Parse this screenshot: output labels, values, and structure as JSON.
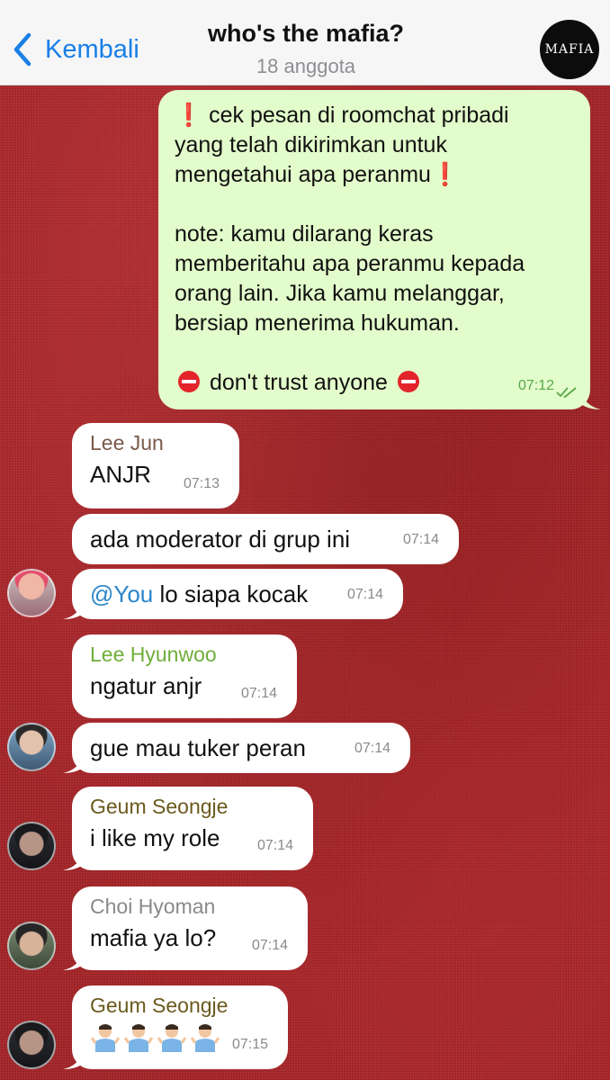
{
  "header": {
    "back_label": "Kembali",
    "title": "who's the mafia?",
    "subtitle": "18 anggota",
    "avatar_text": "MAFIA"
  },
  "colors": {
    "link_blue": "#1a7fe6",
    "outgoing_bubble": "#e3fccb",
    "incoming_bubble": "#ffffff",
    "background_red": "#a5262a"
  },
  "messages": [
    {
      "direction": "out",
      "line1": "cek pesan di roomchat pribadi",
      "line2": "yang telah dikirimkan untuk",
      "line3": "mengetahui apa peranmu",
      "note1": "note: kamu dilarang keras",
      "note2": "memberitahu apa peranmu kepada",
      "note3": "orang lain. Jika kamu melanggar,",
      "note4": "bersiap menerima hukuman.",
      "footer": "don't trust anyone",
      "time": "07:12",
      "status_icon": "double-check-icon"
    },
    {
      "direction": "in",
      "sender": "Lee Jun",
      "sender_color": "#7a5a4b",
      "text": "ANJR",
      "time": "07:13"
    },
    {
      "direction": "in",
      "text": "ada moderator di grup ini",
      "time": "07:14"
    },
    {
      "direction": "in",
      "mention": "@You",
      "text": " lo siapa kocak",
      "time": "07:14"
    },
    {
      "direction": "in",
      "sender": "Lee Hyunwoo",
      "sender_color": "#6fae3a",
      "text": "ngatur anjr",
      "time": "07:14"
    },
    {
      "direction": "in",
      "text": "gue mau tuker peran",
      "time": "07:14"
    },
    {
      "direction": "in",
      "sender": "Geum Seongje",
      "sender_color": "#6b5a1e",
      "text": "i like my role",
      "time": "07:14"
    },
    {
      "direction": "in",
      "sender": "Choi Hyoman",
      "sender_color": "#8a8a8a",
      "text": "mafia ya lo?",
      "time": "07:14"
    },
    {
      "direction": "in",
      "sender": "Geum Seongje",
      "sender_color": "#6b5a1e",
      "emoji": "man-shrugging x4",
      "time": "07:15"
    }
  ]
}
